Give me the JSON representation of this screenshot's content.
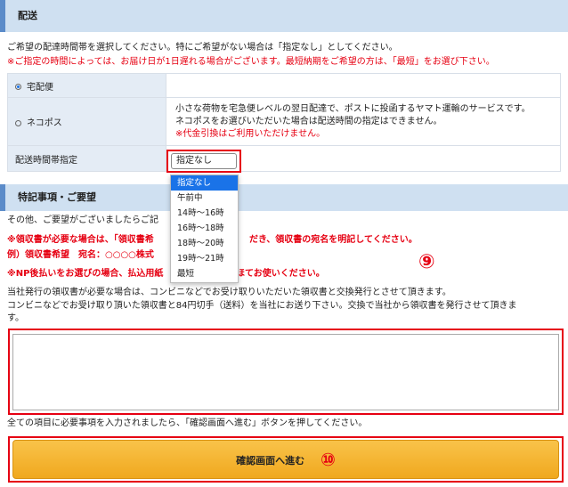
{
  "delivery": {
    "heading": "配送",
    "intro": "ご希望の配達時間帯を選択してください。特にご希望がない場合は「指定なし」としてください。",
    "warning": "※ご指定の時間によっては、お届け日が1日遅れる場合がございます。最短納期をご希望の方は、「最短」をお選び下さい。",
    "options": [
      {
        "label": "宅配便",
        "selected": true
      },
      {
        "label": "ネコポス",
        "selected": false
      }
    ],
    "nekopos_desc_1": "小さな荷物を宅急便レベルの翌日配達で、ポストに投函するヤマト運輸のサービスです。",
    "nekopos_desc_2": "ネコポスをお選びいただいた場合は配送時間の指定はできません。",
    "nekopos_note": "※代金引換はご利用いただけません。",
    "time_label": "配送時間帯指定",
    "time_selected": "指定なし",
    "time_options": [
      "指定なし",
      "午前中",
      "14時～16時",
      "16時～18時",
      "18時～20時",
      "19時～21時",
      "最短"
    ]
  },
  "requests": {
    "heading": "特記事項・ご要望",
    "line1": "その他、ご要望がございましたらご記",
    "line2": "※領収書が必要な場合は、「領収書希",
    "line2b": "だき、領収書の宛名を明記してください。",
    "line3": "例）領収書希望　宛名：○○○○株式",
    "line4": "※NP後払いをお選びの場合、払込用紙",
    "line4b": "ほてお使いください。",
    "line5": "当社発行の領収書が必要な場合は、コンビニなどでお受け取りいただいた領収書と交換発行とさせて頂きます。",
    "line6": "コンビニなどでお受け取り頂いた領収書と84円切手（送料）を当社にお送り下さい。交換で当社から領収書を発行させて頂きま",
    "line7": "す。"
  },
  "footer_note": "全ての項目に必要事項を入力されましたら、「確認画面へ進む」ボタンを押してください。",
  "submit_label": "確認画面へ進む",
  "annotations": {
    "nine": "⑨",
    "ten": "⑩"
  }
}
